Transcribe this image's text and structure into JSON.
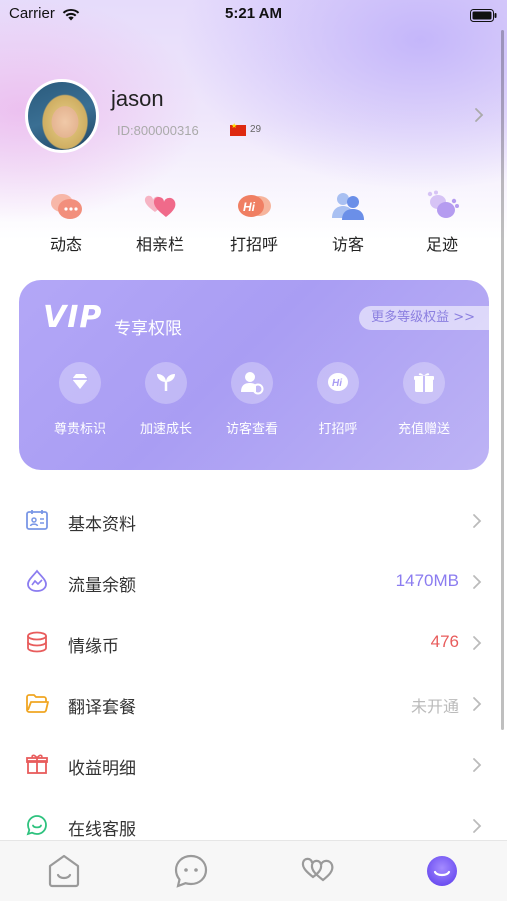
{
  "status_bar": {
    "carrier": "Carrier",
    "time": "5:21 AM"
  },
  "profile": {
    "username": "jason",
    "user_id": "ID:800000316",
    "age": "29"
  },
  "quick_actions": [
    {
      "label": "动态",
      "icon": "moments-icon"
    },
    {
      "label": "相亲栏",
      "icon": "hearts-icon"
    },
    {
      "label": "打招呼",
      "icon": "hi-greeting-icon"
    },
    {
      "label": "访客",
      "icon": "visitors-icon"
    },
    {
      "label": "足迹",
      "icon": "footprints-icon"
    }
  ],
  "vip": {
    "logo": "VIP",
    "subtitle": "专享权限",
    "more_label": "更多等级权益 >>",
    "perks": [
      {
        "label": "尊贵标识",
        "icon": "diamond-icon"
      },
      {
        "label": "加速成长",
        "icon": "sprout-icon"
      },
      {
        "label": "访客查看",
        "icon": "visitor-view-icon"
      },
      {
        "label": "打招呼",
        "icon": "hi-icon"
      },
      {
        "label": "充值赠送",
        "icon": "gift-icon"
      }
    ]
  },
  "menu": [
    {
      "label": "基本资料",
      "value": "",
      "icon": "profile-card-icon"
    },
    {
      "label": "流量余额",
      "value": "1470MB",
      "icon": "data-balance-icon"
    },
    {
      "label": "情缘币",
      "value": "476",
      "icon": "coins-icon"
    },
    {
      "label": "翻译套餐",
      "value": "未开通",
      "icon": "folder-icon"
    },
    {
      "label": "收益明细",
      "value": "",
      "icon": "gift-box-icon"
    },
    {
      "label": "在线客服",
      "value": "",
      "icon": "customer-service-icon"
    }
  ],
  "colors": {
    "accent": "#8b7cf0",
    "vip_card": "#aea2f5",
    "data_value": "#8b7cf0",
    "coin_value": "#e85c5c",
    "muted_value": "#bbbbbb"
  },
  "tabbar": [
    {
      "icon": "home-icon",
      "active": false
    },
    {
      "icon": "chat-icon",
      "active": false
    },
    {
      "icon": "heart-match-icon",
      "active": false
    },
    {
      "icon": "profile-face-icon",
      "active": true
    }
  ]
}
